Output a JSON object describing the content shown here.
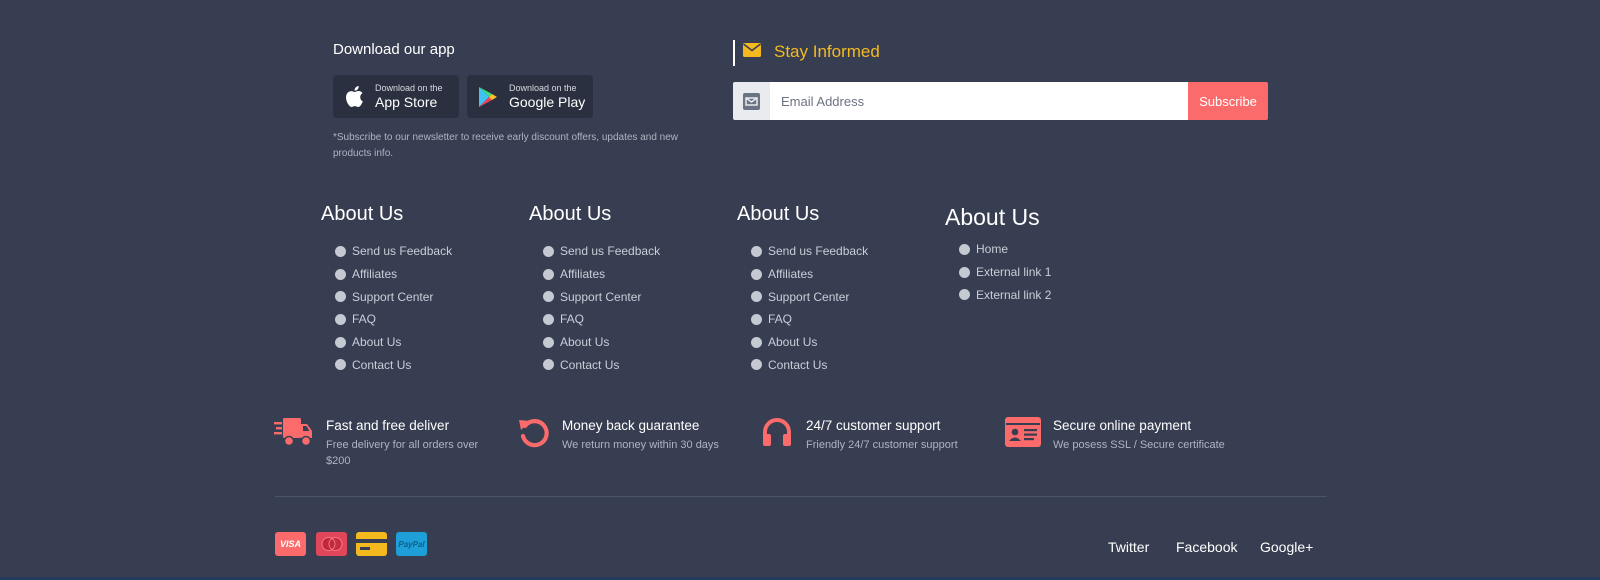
{
  "download": {
    "title": "Download our app",
    "app_store": {
      "small": "Download on the",
      "big": "App Store"
    },
    "google_play": {
      "small": "Download on the",
      "big": "Google Play"
    },
    "note": "*Subscribe to our newsletter to receive early discount offers, updates and new products info."
  },
  "newsletter": {
    "title": "Stay Informed",
    "placeholder": "Email Address",
    "button": "Subscribe"
  },
  "columns": [
    {
      "heading": "About Us",
      "items": [
        "Send us Feedback",
        "Affiliates",
        "Support Center",
        "FAQ",
        "About Us",
        "Contact Us"
      ]
    },
    {
      "heading": "About Us",
      "items": [
        "Send us Feedback",
        "Affiliates",
        "Support Center",
        "FAQ",
        "About Us",
        "Contact Us"
      ]
    },
    {
      "heading": "About Us",
      "items": [
        "Send us Feedback",
        "Affiliates",
        "Support Center",
        "FAQ",
        "About Us",
        "Contact Us"
      ]
    },
    {
      "heading": "About Us",
      "items": [
        "Home",
        "External link 1",
        "External link 2"
      ]
    }
  ],
  "features": [
    {
      "icon": "truck-icon",
      "title": "Fast and free deliver",
      "subtitle": "Free delivery for all orders over $200"
    },
    {
      "icon": "refresh-icon",
      "title": "Money back guarantee",
      "subtitle": "We return money within 30 days"
    },
    {
      "icon": "headphones-icon",
      "title": "24/7 customer support",
      "subtitle": "Friendly 24/7 customer support"
    },
    {
      "icon": "id-card-icon",
      "title": "Secure online payment",
      "subtitle": "We posess SSL / Secure certificate"
    }
  ],
  "payments": [
    {
      "name": "visa-icon",
      "label": "VISA"
    },
    {
      "name": "mastercard-icon",
      "label": ""
    },
    {
      "name": "credit-card-icon",
      "label": ""
    },
    {
      "name": "paypal-icon",
      "label": "PayPal"
    }
  ],
  "social": [
    "Twitter",
    "Facebook",
    "Google+"
  ],
  "colors": {
    "background": "#373e51",
    "accent_red": "#fc6b6b",
    "accent_yellow": "#f5b920",
    "store_button": "#2a303f"
  }
}
